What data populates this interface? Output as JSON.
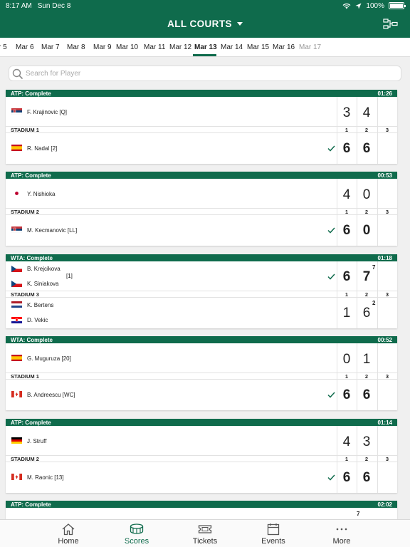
{
  "status_bar": {
    "time": "8:17 AM",
    "date": "Sun Dec 8",
    "battery": "100%"
  },
  "nav": {
    "title": "ALL COURTS"
  },
  "dates": [
    "r 5",
    "Mar 6",
    "Mar 7",
    "Mar 8",
    "Mar 9",
    "Mar 10",
    "Mar 11",
    "Mar 12",
    "Mar 13",
    "Mar 14",
    "Mar 15",
    "Mar 16",
    "Mar 17"
  ],
  "selected_date": "Mar 13",
  "search": {
    "placeholder": "Search for Player"
  },
  "set_labels": [
    "1",
    "2",
    "3"
  ],
  "matches": [
    {
      "status": "ATP: Complete",
      "duration": "01:26",
      "court": "STADIUM 1",
      "p1": "F. Krajinovic [Q]",
      "p2": "R. Nadal [2]",
      "s1": [
        "3",
        "4"
      ],
      "s2": [
        "6",
        "6"
      ]
    },
    {
      "status": "ATP: Complete",
      "duration": "00:53",
      "court": "STADIUM 2",
      "p1": "Y. Nishioka",
      "p2": "M. Kecmanovic [LL]",
      "s1": [
        "4",
        "0"
      ],
      "s2": [
        "6",
        "0"
      ]
    },
    {
      "status": "WTA: Complete",
      "duration": "01:18",
      "court": "STADIUM 3",
      "p1a": "B. Krejcikova",
      "p1b": "K. Siniakova",
      "seed": "[1]",
      "p2a": "K. Bertens",
      "p2b": "D. Vekic",
      "s1": [
        "6",
        "7"
      ],
      "s2": [
        "1",
        "6"
      ],
      "tb1": "7",
      "tb2": "2"
    },
    {
      "status": "WTA: Complete",
      "duration": "00:52",
      "court": "STADIUM 1",
      "p1": "G. Muguruza [20]",
      "p2": "B. Andreescu [WC]",
      "s1": [
        "0",
        "1"
      ],
      "s2": [
        "6",
        "6"
      ]
    },
    {
      "status": "ATP: Complete",
      "duration": "01:14",
      "court": "STADIUM 2",
      "p1": "J. Struff",
      "p2": "M. Raonic [13]",
      "s1": [
        "4",
        "3"
      ],
      "s2": [
        "6",
        "6"
      ]
    },
    {
      "status": "ATP: Complete",
      "duration": "02:02",
      "tb": "7"
    }
  ],
  "tabs": [
    {
      "label": "Home",
      "icon": "home-icon"
    },
    {
      "label": "Scores",
      "icon": "stadium-icon"
    },
    {
      "label": "Tickets",
      "icon": "ticket-icon"
    },
    {
      "label": "Events",
      "icon": "calendar-icon"
    },
    {
      "label": "More",
      "icon": "more-icon"
    }
  ],
  "colors": {
    "brand": "#0f6b4c",
    "winner_check": "#0f6b4c"
  }
}
